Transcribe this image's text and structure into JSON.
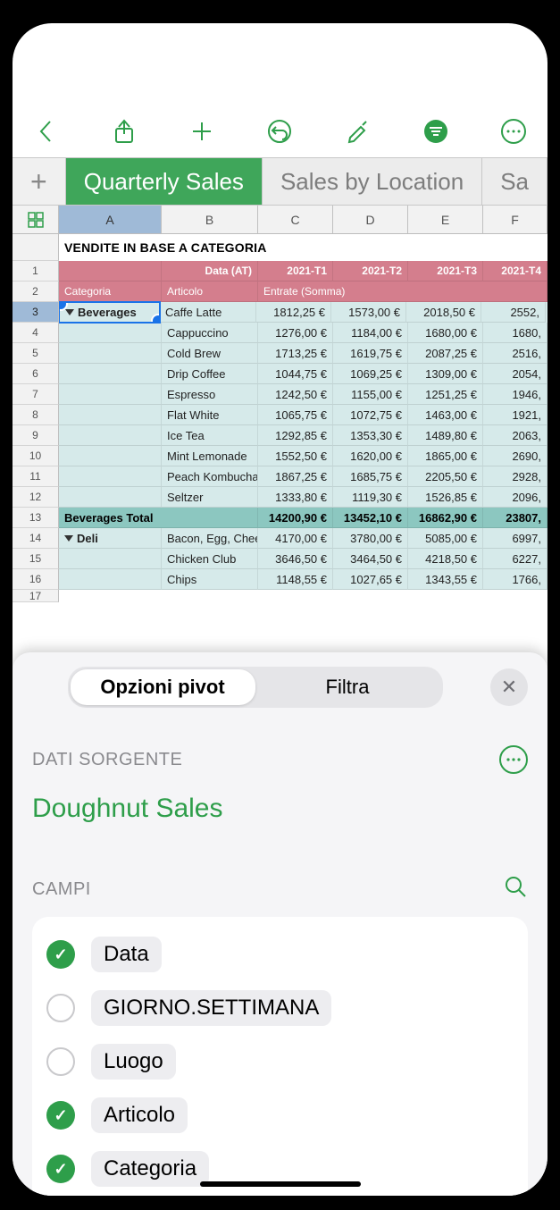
{
  "toolbar": {
    "icons": [
      "back",
      "share",
      "add",
      "undo",
      "format",
      "filter",
      "more"
    ]
  },
  "tabs": {
    "items": [
      {
        "label": "Quarterly Sales",
        "active": true
      },
      {
        "label": "Sales by Location",
        "active": false
      },
      {
        "label": "Sa",
        "active": false
      }
    ]
  },
  "columns": [
    "A",
    "B",
    "C",
    "D",
    "E",
    "F"
  ],
  "selected_column": "A",
  "selected_row": 3,
  "table": {
    "title": "VENDITE IN BASE A CATEGORIA",
    "header1": {
      "a": "",
      "b": "Data (AT)",
      "c": "2021-T1",
      "d": "2021-T2",
      "e": "2021-T3",
      "f": "2021-T4"
    },
    "header2": {
      "a": "Categoria",
      "b": "Articolo",
      "c": "Entrate (Somma)"
    },
    "rows": [
      {
        "n": 3,
        "cat": "Beverages",
        "art": "Caffe Latte",
        "c": "1812,25 €",
        "d": "1573,00 €",
        "e": "2018,50 €",
        "f": "2552,"
      },
      {
        "n": 4,
        "cat": "",
        "art": "Cappuccino",
        "c": "1276,00 €",
        "d": "1184,00 €",
        "e": "1680,00 €",
        "f": "1680,"
      },
      {
        "n": 5,
        "cat": "",
        "art": "Cold Brew",
        "c": "1713,25 €",
        "d": "1619,75 €",
        "e": "2087,25 €",
        "f": "2516,"
      },
      {
        "n": 6,
        "cat": "",
        "art": "Drip Coffee",
        "c": "1044,75 €",
        "d": "1069,25 €",
        "e": "1309,00 €",
        "f": "2054,"
      },
      {
        "n": 7,
        "cat": "",
        "art": "Espresso",
        "c": "1242,50 €",
        "d": "1155,00 €",
        "e": "1251,25 €",
        "f": "1946,"
      },
      {
        "n": 8,
        "cat": "",
        "art": "Flat White",
        "c": "1065,75 €",
        "d": "1072,75 €",
        "e": "1463,00 €",
        "f": "1921,"
      },
      {
        "n": 9,
        "cat": "",
        "art": "Ice Tea",
        "c": "1292,85 €",
        "d": "1353,30 €",
        "e": "1489,80 €",
        "f": "2063,"
      },
      {
        "n": 10,
        "cat": "",
        "art": "Mint Lemonade",
        "c": "1552,50 €",
        "d": "1620,00 €",
        "e": "1865,00 €",
        "f": "2690,"
      },
      {
        "n": 11,
        "cat": "",
        "art": "Peach Kombucha",
        "c": "1867,25 €",
        "d": "1685,75 €",
        "e": "2205,50 €",
        "f": "2928,"
      },
      {
        "n": 12,
        "cat": "",
        "art": "Seltzer",
        "c": "1333,80 €",
        "d": "1119,30 €",
        "e": "1526,85 €",
        "f": "2096,"
      }
    ],
    "total": {
      "n": 13,
      "label": "Beverages Total",
      "c": "14200,90 €",
      "d": "13452,10 €",
      "e": "16862,90 €",
      "f": "23807,"
    },
    "rows2": [
      {
        "n": 14,
        "cat": "Deli",
        "art": "Bacon, Egg, Cheese",
        "c": "4170,00 €",
        "d": "3780,00 €",
        "e": "5085,00 €",
        "f": "6997,"
      },
      {
        "n": 15,
        "cat": "",
        "art": "Chicken Club",
        "c": "3646,50 €",
        "d": "3464,50 €",
        "e": "4218,50 €",
        "f": "6227,"
      },
      {
        "n": 16,
        "cat": "",
        "art": "Chips",
        "c": "1148,55 €",
        "d": "1027,65 €",
        "e": "1343,55 €",
        "f": "1766,"
      }
    ]
  },
  "panel": {
    "segments": {
      "pivot": "Opzioni pivot",
      "filter": "Filtra"
    },
    "source_header": "DATI SORGENTE",
    "source_name": "Doughnut Sales",
    "fields_header": "CAMPI",
    "fields": [
      {
        "label": "Data",
        "checked": true
      },
      {
        "label": "GIORNO.SETTIMANA",
        "checked": false
      },
      {
        "label": "Luogo",
        "checked": false
      },
      {
        "label": "Articolo",
        "checked": true
      },
      {
        "label": "Categoria",
        "checked": true
      }
    ]
  }
}
